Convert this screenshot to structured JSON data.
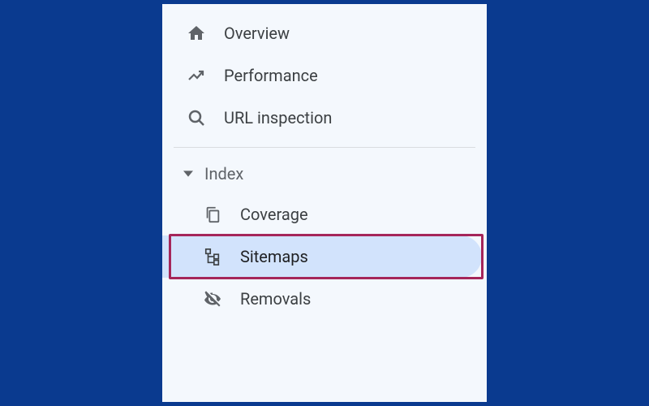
{
  "sidebar": {
    "top_items": [
      {
        "name": "overview",
        "label": "Overview",
        "icon": "home-icon"
      },
      {
        "name": "performance",
        "label": "Performance",
        "icon": "trending-icon"
      },
      {
        "name": "url-inspection",
        "label": "URL inspection",
        "icon": "search-icon"
      }
    ],
    "section": {
      "label": "Index",
      "expanded": true,
      "items": [
        {
          "name": "coverage",
          "label": "Coverage",
          "icon": "copy-icon",
          "selected": false
        },
        {
          "name": "sitemaps",
          "label": "Sitemaps",
          "icon": "tree-icon",
          "selected": true,
          "highlighted": true
        },
        {
          "name": "removals",
          "label": "Removals",
          "icon": "visibility-off-icon",
          "selected": false
        }
      ]
    }
  }
}
